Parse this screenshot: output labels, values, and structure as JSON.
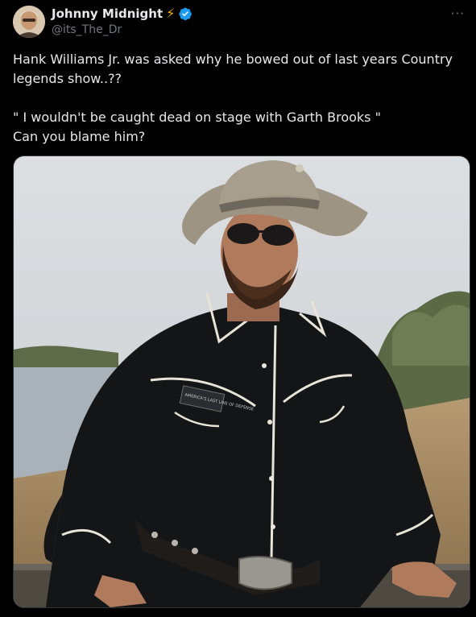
{
  "author": {
    "display_name": "Johnny Midnight",
    "emoji": "⚡",
    "handle": "@its_The_Dr",
    "verified": true
  },
  "tweet": {
    "text": "Hank Williams Jr. was asked why he bowed out of last years Country legends show..??\n\n\" I wouldn't be caught dead on stage with Garth Brooks \"\nCan you blame him?"
  },
  "menu": {
    "more_label": "···"
  },
  "media": {
    "patch_text": "AMERICA'S LAST LINE OF DEFENSE"
  },
  "colors": {
    "background": "#000000",
    "text": "#e7e9ea",
    "secondary_text": "#71767b",
    "verified_blue": "#1d9bf0",
    "bolt": "#f7b500"
  },
  "icons": [
    "lightning-icon",
    "verified-badge-icon",
    "more-options-icon"
  ]
}
